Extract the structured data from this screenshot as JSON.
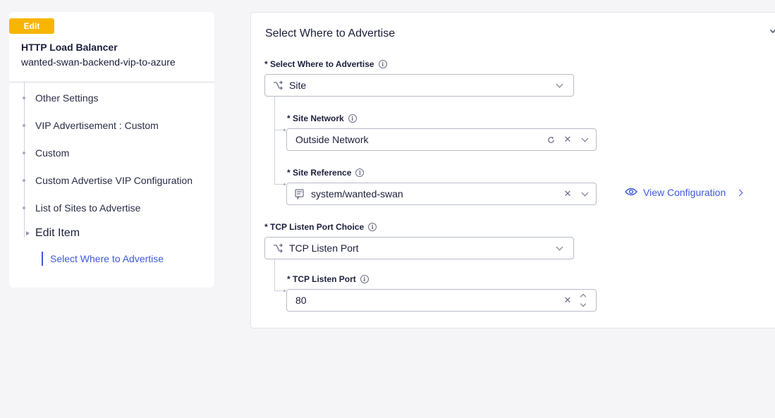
{
  "sidebar": {
    "badge": "Edit",
    "title": "HTTP Load Balancer",
    "subtitle": "wanted-swan-backend-vip-to-azure",
    "items": [
      {
        "label": "Other Settings"
      },
      {
        "label": "VIP Advertisement : Custom"
      },
      {
        "label": "Custom"
      },
      {
        "label": "Custom Advertise VIP Configuration"
      },
      {
        "label": "List of Sites to Advertise"
      }
    ],
    "current": "Edit Item",
    "active_child": "Select Where to Advertise"
  },
  "panel": {
    "title": "Select Where to Advertise",
    "where_label": "* Select Where to Advertise",
    "where_value": "Site",
    "site_network_label": "* Site Network",
    "site_network_value": "Outside Network",
    "site_reference_label": "* Site Reference",
    "site_reference_value": "system/wanted-swan",
    "view_config": "View Configuration",
    "tcp_choice_label": "* TCP Listen Port Choice",
    "tcp_choice_value": "TCP Listen Port",
    "tcp_port_label": "* TCP Listen Port",
    "tcp_port_value": "80"
  },
  "colors": {
    "accent": "#3d5adb",
    "badge": "#f8b500"
  },
  "icons": [
    "branch-icon",
    "info-icon",
    "chevron-down-icon",
    "refresh-icon",
    "clear-icon",
    "document-icon",
    "eye-icon",
    "chevron-right-icon",
    "stepper-up-icon",
    "stepper-down-icon"
  ]
}
